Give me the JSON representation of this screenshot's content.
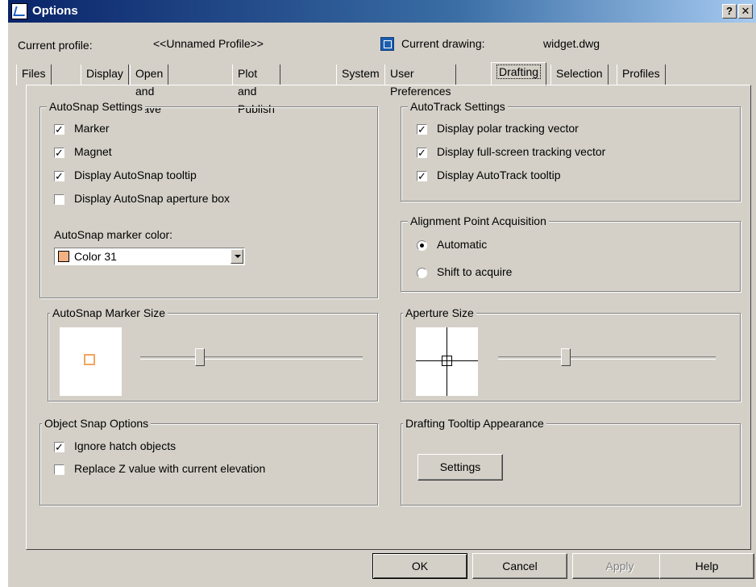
{
  "window": {
    "title": "Options",
    "help_btn": "?",
    "close_btn": "✕"
  },
  "header": {
    "profile_label": "Current profile:",
    "profile_value": "<<Unnamed Profile>>",
    "drawing_label": "Current drawing:",
    "drawing_value": "widget.dwg"
  },
  "tabs": [
    "Files",
    "Display",
    "Open and Save",
    "Plot and Publish",
    "System",
    "User Preferences",
    "Drafting",
    "Selection",
    "Profiles"
  ],
  "active_tab": "Drafting",
  "autosnap": {
    "title": "AutoSnap Settings",
    "marker": {
      "label": "Marker",
      "checked": true
    },
    "magnet": {
      "label": "Magnet",
      "checked": true
    },
    "tooltip": {
      "label": "Display AutoSnap tooltip",
      "checked": true
    },
    "aperture_box": {
      "label": "Display AutoSnap aperture box",
      "checked": false
    },
    "color_label": "AutoSnap marker color:",
    "color_value": "Color 31",
    "color_swatch": "#f4b183"
  },
  "autotrack": {
    "title": "AutoTrack Settings",
    "polar": {
      "label": "Display polar tracking vector",
      "checked": true
    },
    "fullscreen": {
      "label": "Display full-screen tracking vector",
      "checked": true
    },
    "tooltip": {
      "label": "Display AutoTrack tooltip",
      "checked": true
    }
  },
  "alignment": {
    "title": "Alignment Point Acquisition",
    "automatic": {
      "label": "Automatic",
      "selected": true
    },
    "shift": {
      "label": "Shift to acquire",
      "selected": false
    }
  },
  "marker_size": {
    "title": "AutoSnap Marker Size",
    "level": 0.27
  },
  "aperture_size": {
    "title": "Aperture Size",
    "level": 0.3
  },
  "object_snap": {
    "title": "Object Snap Options",
    "ignore_hatch": {
      "label": "Ignore hatch objects",
      "checked": true
    },
    "replace_z": {
      "label": "Replace Z value with current elevation",
      "checked": false
    }
  },
  "tooltip_appearance": {
    "title": "Drafting Tooltip Appearance",
    "settings_btn": "Settings"
  },
  "footer": {
    "ok": "OK",
    "cancel": "Cancel",
    "apply": "Apply",
    "help": "Help"
  },
  "colors": {
    "disabled_text": "#808080",
    "marker_orange": "#f4a460"
  }
}
